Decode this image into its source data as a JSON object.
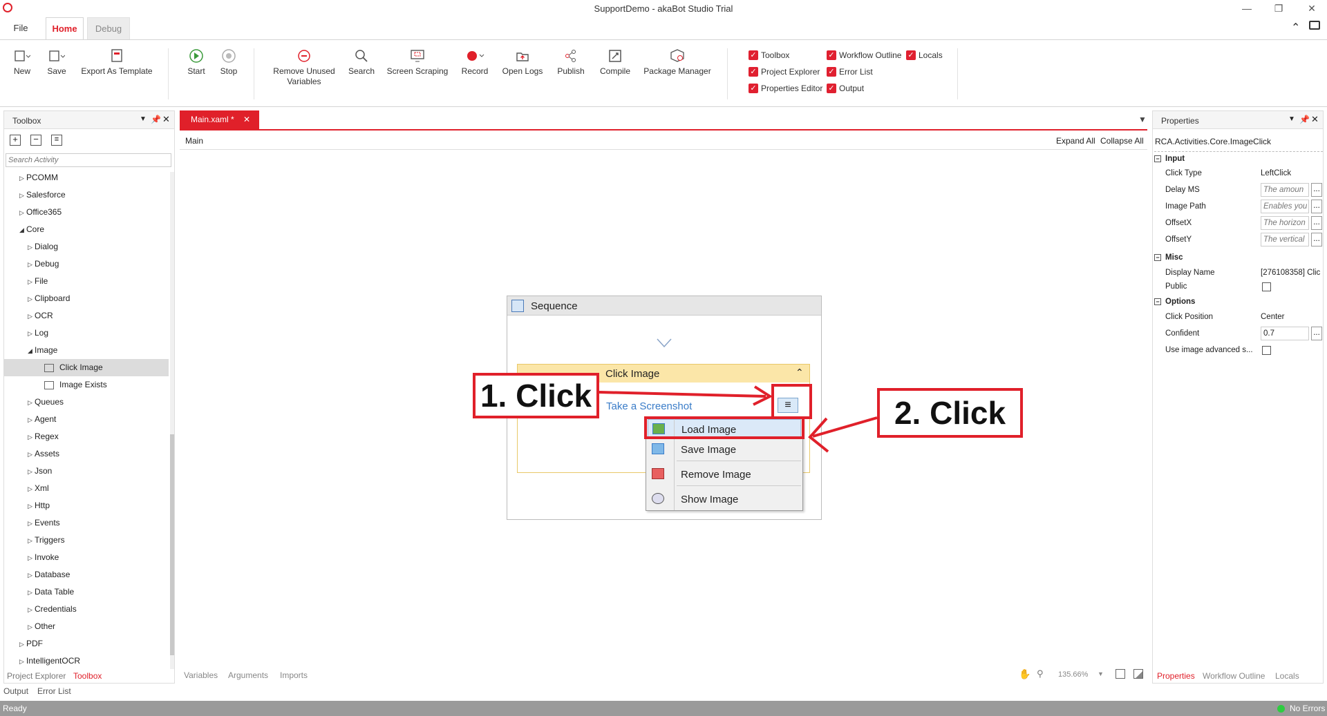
{
  "app": {
    "window_title": "SupportDemo - akaBot Studio Trial",
    "status_left": "Ready",
    "status_right": "No Errors"
  },
  "ribbon_tabs": [
    {
      "label": "File"
    },
    {
      "label": "Home"
    },
    {
      "label": "Debug"
    }
  ],
  "ribbon": {
    "buttons": [
      {
        "label": "New",
        "icon": "new-file-icon"
      },
      {
        "label": "Save",
        "icon": "save-icon"
      },
      {
        "label": "Export As Template",
        "icon": "export-template-icon"
      },
      {
        "label": "Start",
        "icon": "play-icon"
      },
      {
        "label": "Stop",
        "icon": "stop-icon"
      },
      {
        "label": "Remove Unused\nVariables",
        "icon": "remove-icon"
      },
      {
        "label": "Search",
        "icon": "search-icon"
      },
      {
        "label": "Screen Scraping",
        "icon": "screen-scraping-icon"
      },
      {
        "label": "Record",
        "icon": "record-icon"
      },
      {
        "label": "Open Logs",
        "icon": "open-logs-icon"
      },
      {
        "label": "Publish",
        "icon": "share-icon"
      },
      {
        "label": "Compile",
        "icon": "compile-icon"
      },
      {
        "label": "Package Manager",
        "icon": "package-icon"
      }
    ],
    "checkboxes": [
      {
        "label": "Toolbox",
        "checked": true
      },
      {
        "label": "Project Explorer",
        "checked": true
      },
      {
        "label": "Properties Editor",
        "checked": true
      },
      {
        "label": "Workflow Outline",
        "checked": true
      },
      {
        "label": "Error List",
        "checked": true
      },
      {
        "label": "Output",
        "checked": true
      },
      {
        "label": "Locals",
        "checked": true
      }
    ]
  },
  "toolbox": {
    "title": "Toolbox",
    "search_placeholder": "Search Activity",
    "items": [
      {
        "label": "PCOMM",
        "expanded": false
      },
      {
        "label": "Salesforce",
        "expanded": false
      },
      {
        "label": "Office365",
        "expanded": false
      },
      {
        "label": "Core",
        "expanded": true
      },
      {
        "label": "Dialog",
        "expanded": false
      },
      {
        "label": "Debug",
        "expanded": false
      },
      {
        "label": "File",
        "expanded": false
      },
      {
        "label": "Clipboard",
        "expanded": false
      },
      {
        "label": "OCR",
        "expanded": false
      },
      {
        "label": "Log",
        "expanded": false
      },
      {
        "label": "Image",
        "expanded": true
      },
      {
        "label": "Click Image",
        "selected": true
      },
      {
        "label": "Image Exists"
      },
      {
        "label": "Queues",
        "expanded": false
      },
      {
        "label": "Agent",
        "expanded": false
      },
      {
        "label": "Regex",
        "expanded": false
      },
      {
        "label": "Assets",
        "expanded": false
      },
      {
        "label": "Json",
        "expanded": false
      },
      {
        "label": "Xml",
        "expanded": false
      },
      {
        "label": "Http",
        "expanded": false
      },
      {
        "label": "Events",
        "expanded": false
      },
      {
        "label": "Triggers",
        "expanded": false
      },
      {
        "label": "Invoke",
        "expanded": false
      },
      {
        "label": "Database",
        "expanded": false
      },
      {
        "label": "Data Table",
        "expanded": false
      },
      {
        "label": "Credentials",
        "expanded": false
      },
      {
        "label": "Other",
        "expanded": false
      },
      {
        "label": "PDF",
        "expanded": false
      },
      {
        "label": "IntelligentOCR",
        "expanded": false
      }
    ],
    "bottom_tabs": [
      "Project Explorer",
      "Toolbox"
    ],
    "bottom_tabs2": [
      "Output",
      "Error List"
    ]
  },
  "editor": {
    "tab_label": "Main.xaml *",
    "breadcrumb": "Main",
    "expand_all": "Expand All",
    "collapse_all": "Collapse All",
    "sequence_title": "Sequence",
    "activity_title": "Click Image",
    "take_screenshot": "Take a Screenshot",
    "context_menu": [
      "Load Image",
      "Save Image",
      "Remove Image",
      "Show Image"
    ],
    "bottom_tabs": [
      "Variables",
      "Arguments",
      "Imports"
    ],
    "zoom": "135.66%"
  },
  "annotations": {
    "step1": "1. Click",
    "step2": "2. Click",
    "color": "#e0202a"
  },
  "properties": {
    "title": "Properties",
    "type_name": "RCA.Activities.Core.ImageClick",
    "sections": [
      {
        "name": "Input",
        "rows": [
          {
            "label": "Click Type",
            "value": "LeftClick"
          },
          {
            "label": "Delay MS",
            "value": "The amoun"
          },
          {
            "label": "Image Path",
            "value": "Enables you"
          },
          {
            "label": "OffsetX",
            "value": "The horizon"
          },
          {
            "label": "OffsetY",
            "value": "The vertical"
          }
        ]
      },
      {
        "name": "Misc",
        "rows": [
          {
            "label": "Display Name",
            "value": "[276108358] Clic"
          },
          {
            "label": "Public",
            "value": ""
          }
        ]
      },
      {
        "name": "Options",
        "rows": [
          {
            "label": "Click Position",
            "value": "Center"
          },
          {
            "label": "Confident",
            "value": "0.7"
          },
          {
            "label": "Use image advanced s...",
            "value": ""
          }
        ]
      }
    ],
    "bottom_tabs": [
      "Properties",
      "Workflow Outline",
      "Locals"
    ]
  },
  "colors": {
    "accent": "#e0202a",
    "status_bar": "#9a9a9a",
    "activity_header": "#fbe6a8"
  }
}
